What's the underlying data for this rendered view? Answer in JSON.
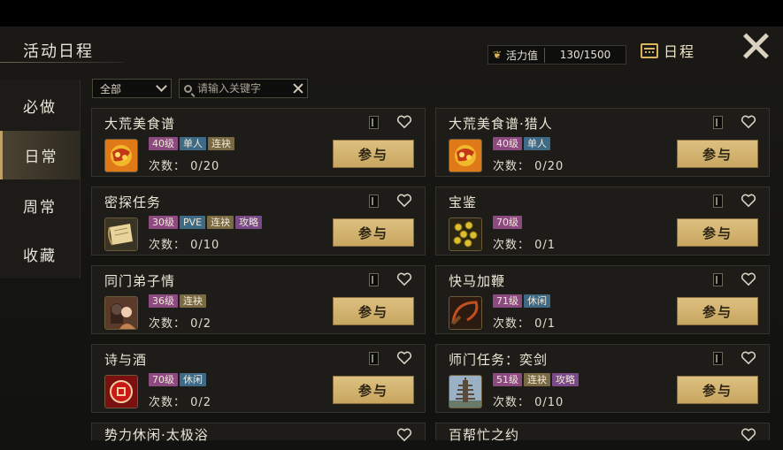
{
  "header": {
    "title": "活动日程",
    "vitality_label": "活力值",
    "vitality_value": "130/1500",
    "calendar_label": "日程"
  },
  "sidebar": {
    "items": [
      {
        "label": "必做",
        "active": false
      },
      {
        "label": "日常",
        "active": true
      },
      {
        "label": "周常",
        "active": false
      },
      {
        "label": "收藏",
        "active": false
      }
    ]
  },
  "filter": {
    "select_value": "全部",
    "search_placeholder": "请输入关键字"
  },
  "join_label": "参与",
  "activities": [
    {
      "title": "大荒美食谱",
      "tags": [
        "40级",
        "单人",
        "连袂"
      ],
      "count": "次数： 0/20",
      "icon": "food-icon"
    },
    {
      "title": "大荒美食谱·猎人",
      "tags": [
        "40级",
        "单人"
      ],
      "count": "次数： 0/20",
      "icon": "food-icon"
    },
    {
      "title": "密探任务",
      "tags": [
        "30级",
        "PVE",
        "连袂",
        "攻略"
      ],
      "count": "次数： 0/10",
      "icon": "scroll-icon"
    },
    {
      "title": "宝鉴",
      "tags": [
        "70级"
      ],
      "count": "次数： 0/1",
      "icon": "coins-icon"
    },
    {
      "title": "同门弟子情",
      "tags": [
        "36级",
        "连袂"
      ],
      "count": "次数： 0/2",
      "icon": "portrait-icon"
    },
    {
      "title": "快马加鞭",
      "tags": [
        "71级",
        "休闲"
      ],
      "count": "次数： 0/1",
      "icon": "whip-icon"
    },
    {
      "title": "诗与酒",
      "tags": [
        "70级",
        "休闲"
      ],
      "count": "次数： 0/2",
      "icon": "wine-icon"
    },
    {
      "title": "师门任务：奕剑",
      "tags": [
        "51级",
        "连袂",
        "攻略"
      ],
      "count": "次数： 0/10",
      "icon": "pagoda-icon"
    }
  ],
  "partial_activities": [
    {
      "title": "势力休闲·太极浴"
    },
    {
      "title": "百帮忙之约"
    }
  ],
  "colors": {
    "gold_button": "#d4b674",
    "tag_level": "#8d4a80",
    "tag_mode": "#3e6a86",
    "tag_team": "#7a6a44",
    "tag_guide": "#7a4a88"
  }
}
